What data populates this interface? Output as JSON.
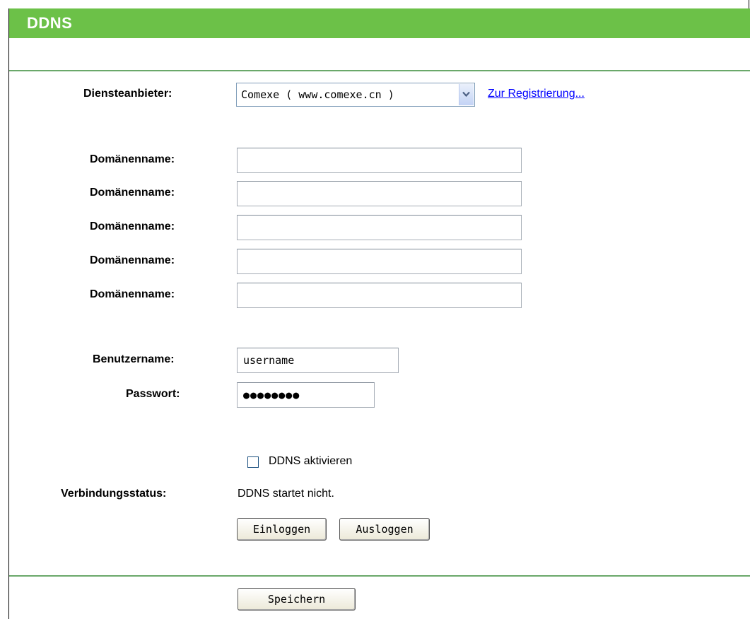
{
  "header": {
    "title": "DDNS"
  },
  "provider": {
    "label": "Diensteanbieter:",
    "selected": "Comexe ( www.comexe.cn )",
    "register_link": "Zur Registrierung..."
  },
  "domains": {
    "label": "Domänenname:",
    "values": [
      "",
      "",
      "",
      "",
      ""
    ]
  },
  "account": {
    "username_label": "Benutzername:",
    "username_value": "username",
    "password_label": "Passwort:",
    "password_value": "●●●●●●●●"
  },
  "ddns": {
    "enable_label": "DDNS aktivieren",
    "enabled": false,
    "status_label": "Verbindungsstatus:",
    "status_value": "DDNS startet nicht.",
    "login_button": "Einloggen",
    "logout_button": "Ausloggen"
  },
  "footer": {
    "save_button": "Speichern"
  },
  "colors": {
    "header_bg": "#6cc148",
    "rule": "#6aa86a",
    "link": "#0000ff"
  }
}
